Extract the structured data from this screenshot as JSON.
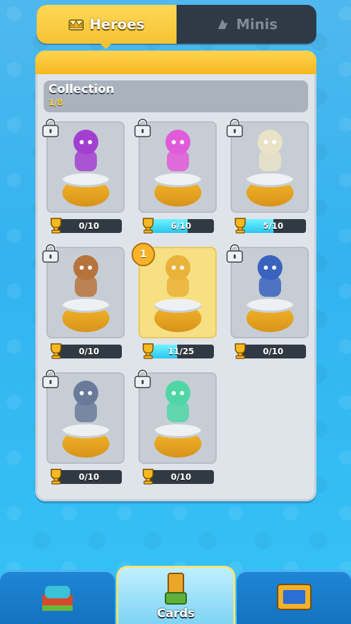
{
  "tabs": [
    {
      "label": "Heroes",
      "icon": "crown-icon",
      "active": true
    },
    {
      "label": "Minis",
      "icon": "mini-icon",
      "active": false
    }
  ],
  "collection": {
    "title": "Collection",
    "count": "1/8"
  },
  "cards": [
    {
      "name": "archer-queen",
      "progress": "0/10",
      "fill": 0,
      "locked": true,
      "level": null,
      "color": "#a33fd0"
    },
    {
      "name": "mini-pink",
      "progress": "6/10",
      "fill": 0.6,
      "locked": true,
      "level": null,
      "color": "#e05bd9"
    },
    {
      "name": "golden-knight",
      "progress": "5/10",
      "fill": 0.5,
      "locked": true,
      "level": null,
      "color": "#e9e2c6"
    },
    {
      "name": "barbarian",
      "progress": "0/10",
      "fill": 0,
      "locked": true,
      "level": null,
      "color": "#b7733c"
    },
    {
      "name": "king",
      "progress": "11/25",
      "fill": 0.44,
      "locked": false,
      "level": "1",
      "color": "#e9b33a"
    },
    {
      "name": "shield-warrior",
      "progress": "0/10",
      "fill": 0,
      "locked": true,
      "level": null,
      "color": "#3a63c0"
    },
    {
      "name": "mech-knight",
      "progress": "0/10",
      "fill": 0,
      "locked": true,
      "level": null,
      "color": "#6a7b9a"
    },
    {
      "name": "green-wizard",
      "progress": "0/10",
      "fill": 0,
      "locked": true,
      "level": null,
      "color": "#4fd6a7"
    }
  ],
  "nav": {
    "center_label": "Cards"
  },
  "colors": {
    "accent": "#f6c233",
    "progress": "#29c6ee",
    "panel": "#dfe4ea"
  }
}
